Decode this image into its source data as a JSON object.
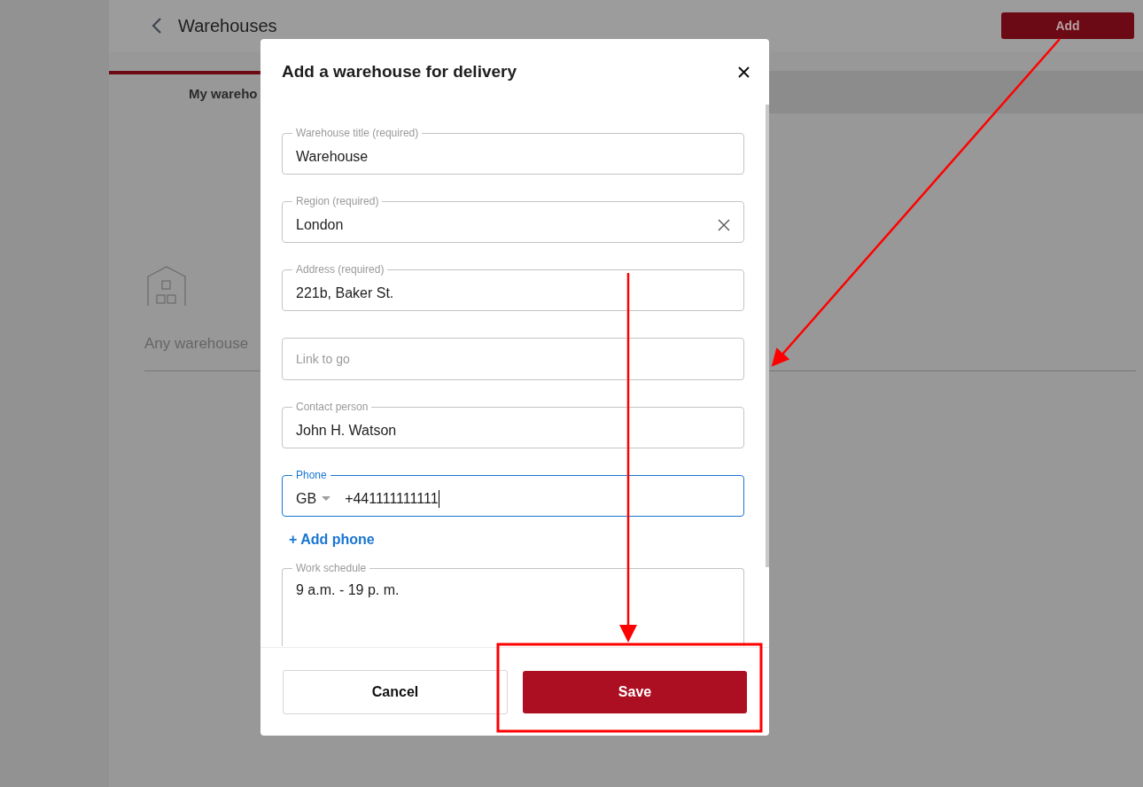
{
  "page": {
    "title": "Warehouses",
    "add_button": "Add",
    "tabs": [
      {
        "label": "My wareho",
        "selected": true
      }
    ],
    "empty_text": "Any warehouse"
  },
  "dialog": {
    "title": "Add a warehouse for delivery",
    "fields": [
      {
        "kind": "text",
        "label": "Warehouse title (required)",
        "value": "Warehouse"
      },
      {
        "kind": "clearable",
        "label": "Region (required)",
        "value": "London"
      },
      {
        "kind": "text",
        "label": "Address (required)",
        "value": "221b, Baker St."
      },
      {
        "kind": "empty",
        "placeholder": "Link to go"
      },
      {
        "kind": "text",
        "label": "Contact person",
        "value": "John H. Watson"
      },
      {
        "kind": "phone",
        "label": "Phone",
        "country": "GB",
        "value": "+441111111111",
        "focused": true
      }
    ],
    "add_phone": "+ Add phone",
    "schedule": {
      "label": "Work schedule",
      "value": "9 a.m. - 19 p. m."
    },
    "cancel": "Cancel",
    "save": "Save"
  }
}
